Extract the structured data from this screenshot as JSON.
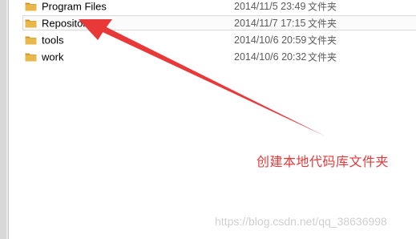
{
  "files": [
    {
      "name": "Program Files",
      "date": "2014/11/5 23:49",
      "type": "文件夹",
      "icon": "folder-icon"
    },
    {
      "name": "Repositories",
      "date": "2014/11/7 17:15",
      "type": "文件夹",
      "icon": "folder-icon",
      "hovered": true
    },
    {
      "name": "tools",
      "date": "2014/10/6 20:59",
      "type": "文件夹",
      "icon": "folder-icon"
    },
    {
      "name": "work",
      "date": "2014/10/6 20:32",
      "type": "文件夹",
      "icon": "folder-icon"
    }
  ],
  "annotation": {
    "text": "创建本地代码库文件夹",
    "color": "#e23a3a"
  },
  "watermark": "https://blog.csdn.net/qq_38636998",
  "colors": {
    "folder": "#e8b84a",
    "folder_dark": "#c9952c",
    "arrow": "#e83838"
  }
}
